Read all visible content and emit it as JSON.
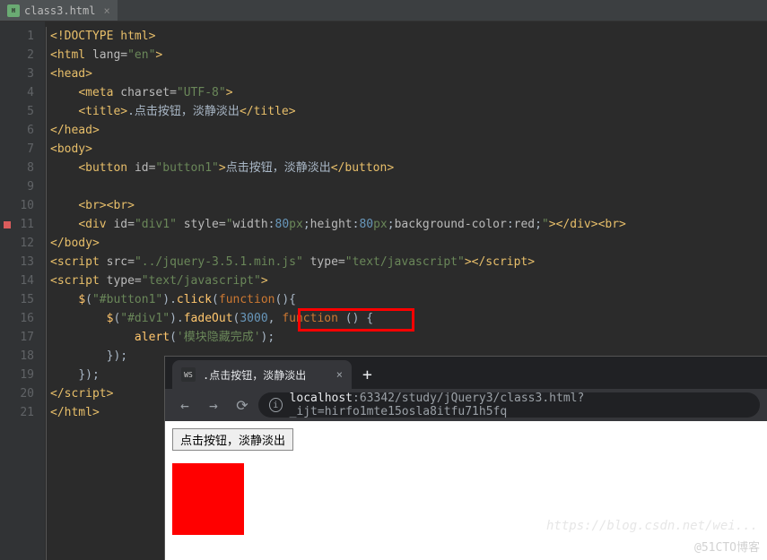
{
  "ide": {
    "tab": {
      "filename": "class3.html",
      "icon": "H"
    },
    "lines": [
      {
        "n": 1,
        "html": "<span class='t-tag'>&lt;!DOCTYPE html&gt;</span>"
      },
      {
        "n": 2,
        "html": "<span class='t-tag'>&lt;html </span><span class='t-attr'>lang=</span><span class='t-val'>\"en\"</span><span class='t-tag'>&gt;</span>"
      },
      {
        "n": 3,
        "html": "<span class='t-tag'>&lt;head&gt;</span>"
      },
      {
        "n": 4,
        "html": "    <span class='t-tag'>&lt;meta </span><span class='t-attr'>charset=</span><span class='t-val'>\"UTF-8\"</span><span class='t-tag'>&gt;</span>"
      },
      {
        "n": 5,
        "html": "    <span class='t-tag'>&lt;title&gt;</span><span class='t-txt'>.点击按钮，淡静淡出</span><span class='t-tag'>&lt;/title&gt;</span>"
      },
      {
        "n": 6,
        "html": "<span class='t-tag'>&lt;/head&gt;</span>"
      },
      {
        "n": 7,
        "html": "<span class='t-tag'>&lt;body&gt;</span>"
      },
      {
        "n": 8,
        "html": "    <span class='t-tag'>&lt;button </span><span class='t-attr'>id=</span><span class='t-val'>\"button1\"</span><span class='t-tag'>&gt;</span><span class='t-txt'>点击按钮，淡静淡出</span><span class='t-tag'>&lt;/button&gt;</span>"
      },
      {
        "n": 9,
        "html": ""
      },
      {
        "n": 10,
        "html": "    <span class='t-tag'>&lt;br&gt;&lt;br&gt;</span>"
      },
      {
        "n": 11,
        "bp": true,
        "html": "    <span class='t-tag'>&lt;div </span><span class='t-attr'>id=</span><span class='t-val'>\"div1\"</span><span class='t-attr'> style=</span><span class='t-val'>\"</span><span class='t-attr'>width</span><span class='t-punc'>:</span><span class='t-num'>80</span><span class='t-val'>px</span><span class='t-punc'>;</span><span class='t-attr'>height</span><span class='t-punc'>:</span><span class='t-num'>80</span><span class='t-val'>px</span><span class='t-punc'>;</span><span class='t-attr'>background-color</span><span class='t-punc'>:</span><span class='t-attr'>red</span><span class='t-punc'>;</span><span class='t-val'>\"</span><span class='t-tag'>&gt;&lt;/div&gt;&lt;br&gt;</span>"
      },
      {
        "n": 12,
        "html": "<span class='t-tag'>&lt;/body&gt;</span>"
      },
      {
        "n": 13,
        "html": "<span class='t-tag'>&lt;script </span><span class='t-attr'>src=</span><span class='t-val'>\"../jquery-3.5.1.min.js\"</span><span class='t-attr'> type=</span><span class='t-val'>\"text/javascript\"</span><span class='t-tag'>&gt;&lt;/script&gt;</span>"
      },
      {
        "n": 14,
        "html": "<span class='t-tag'>&lt;script </span><span class='t-attr'>type=</span><span class='t-val'>\"text/javascript\"</span><span class='t-tag'>&gt;</span>"
      },
      {
        "n": 15,
        "html": "    <span class='t-fn'>$</span><span class='t-punc'>(</span><span class='t-str'>\"#button1\"</span><span class='t-punc'>).</span><span class='t-fn'>click</span><span class='t-punc'>(</span><span class='t-kw'>function</span><span class='t-punc'>(){</span>"
      },
      {
        "n": 16,
        "html": "        <span class='t-fn'>$</span><span class='t-punc'>(</span><span class='t-str'>\"#div1\"</span><span class='t-punc'>).</span><span class='t-fn'>fadeOut</span><span class='t-punc'>(</span><span class='t-num'>3000</span><span class='t-punc'>, </span><span class='t-kw'>function </span><span class='t-punc'>() {</span>"
      },
      {
        "n": 17,
        "html": "            <span class='t-fn'>alert</span><span class='t-punc'>(</span><span class='t-str'>'模块隐藏完成'</span><span class='t-punc'>);</span>"
      },
      {
        "n": 18,
        "html": "        <span class='t-punc'>});</span>"
      },
      {
        "n": 19,
        "html": "    <span class='t-punc'>});</span>"
      },
      {
        "n": 20,
        "html": "<span class='t-tag'>&lt;/script&gt;</span>"
      },
      {
        "n": 21,
        "html": "<span class='t-tag'>&lt;/html&gt;</span>"
      }
    ]
  },
  "browser": {
    "tab_title": ".点击按钮，淡静淡出",
    "favicon": "WS",
    "url": {
      "host": "localhost",
      "path": ":63342/study/jQuery3/class3.html?_ijt=hirfo1mte15osla8itfu71h5fq"
    },
    "page": {
      "button_label": "点击按钮，淡静淡出"
    }
  },
  "watermark": {
    "line1": "https://blog.csdn.net/wei...",
    "line2": "@51CTO博客"
  }
}
